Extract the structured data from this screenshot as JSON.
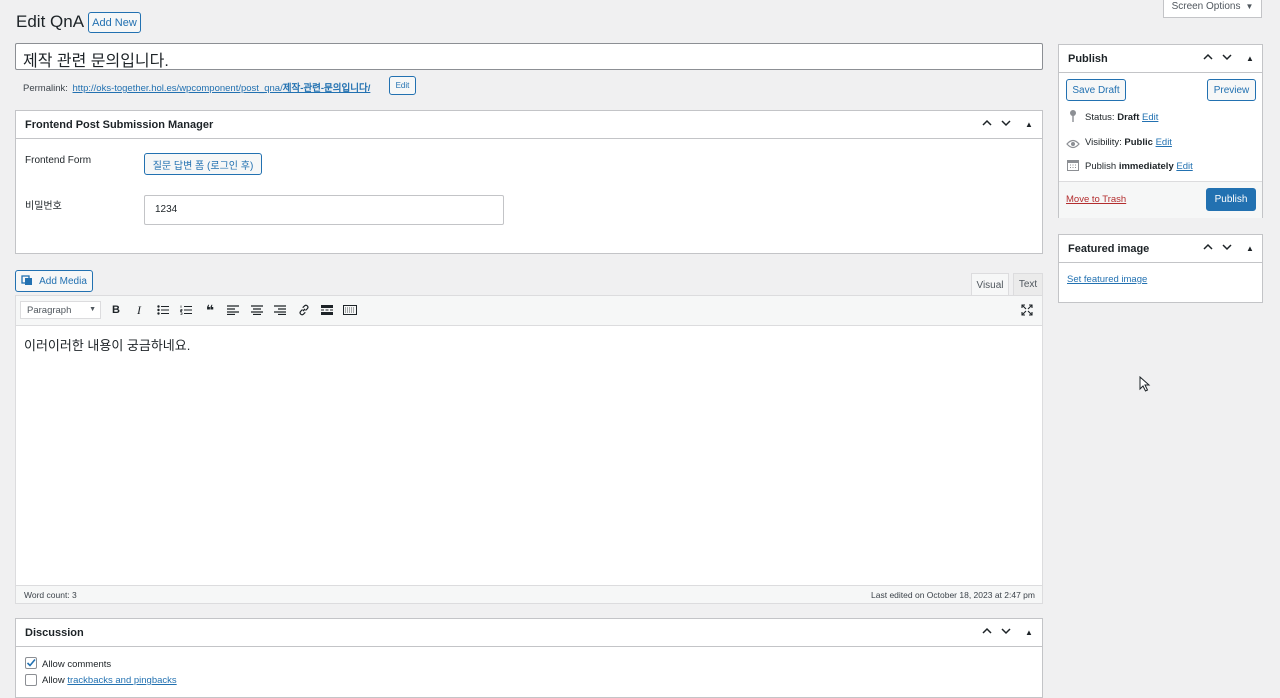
{
  "header": {
    "title": "Edit QnA",
    "add_new": "Add New",
    "screen_options": "Screen Options"
  },
  "post": {
    "title": "제작 관련 문의입니다.",
    "permalink_label": "Permalink:",
    "permalink_base": "http://oks-together.hol.es/wpcomponent/post_qna/",
    "permalink_slug": "제작-관련-문의입니다/",
    "permalink_edit": "Edit"
  },
  "fpsm": {
    "title": "Frontend Post Submission Manager",
    "form_label": "Frontend Form",
    "form_value": "질문 답변 폼 (로그인 후)",
    "password_label": "비밀번호",
    "password_value": "1234"
  },
  "editor": {
    "add_media": "Add Media",
    "tab_visual": "Visual",
    "tab_text": "Text",
    "format_select": "Paragraph",
    "content": "이러이러한 내용이 궁금하네요.",
    "word_count": "Word count: 3",
    "last_edited": "Last edited on October 18, 2023 at 2:47 pm"
  },
  "discussion": {
    "title": "Discussion",
    "allow_comments": "Allow comments",
    "allow_trackbacks_prefix": "Allow ",
    "allow_trackbacks_link": "trackbacks and pingbacks",
    "allow_comments_checked": true,
    "allow_trackbacks_checked": false
  },
  "publish": {
    "title": "Publish",
    "save_draft": "Save Draft",
    "preview": "Preview",
    "status_label": "Status:",
    "status_value": "Draft",
    "visibility_label": "Visibility:",
    "visibility_value": "Public",
    "publish_label": "Publish",
    "publish_value": "immediately",
    "edit": "Edit",
    "move_to_trash": "Move to Trash",
    "publish_button": "Publish"
  },
  "featured_image": {
    "title": "Featured image",
    "set_link": "Set featured image"
  },
  "colors": {
    "accent": "#2271b1",
    "trash": "#b32d2e",
    "background": "#f0f0f1",
    "border": "#c3c4c7"
  },
  "icons": [
    "chevron-up-icon",
    "chevron-down-icon",
    "toggle-arrow-icon",
    "pin-icon",
    "eye-icon",
    "calendar-icon",
    "add-media-icon",
    "bold-icon",
    "italic-icon",
    "bullet-list-icon",
    "numbered-list-icon",
    "blockquote-icon",
    "align-left-icon",
    "align-center-icon",
    "align-right-icon",
    "link-icon",
    "read-more-icon",
    "toolbar-toggle-icon",
    "fullscreen-icon",
    "cursor-icon"
  ]
}
